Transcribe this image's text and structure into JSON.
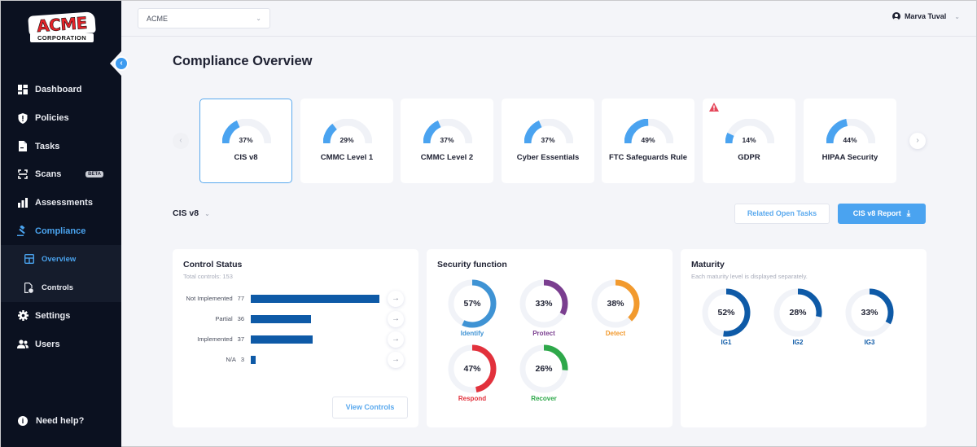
{
  "brand": {
    "logo_top": "ACME",
    "logo_bottom": "CORPORATION"
  },
  "sidebar": {
    "collapse_icon": "chevron-left-icon",
    "items": [
      {
        "label": "Dashboard",
        "icon": "dashboard-icon"
      },
      {
        "label": "Policies",
        "icon": "shield-icon"
      },
      {
        "label": "Tasks",
        "icon": "document-icon"
      },
      {
        "label": "Scans",
        "icon": "scan-icon",
        "badge": "BETA"
      },
      {
        "label": "Assessments",
        "icon": "bar-chart-icon"
      },
      {
        "label": "Compliance",
        "icon": "gavel-icon",
        "active": true
      }
    ],
    "sub_items": [
      {
        "label": "Overview",
        "icon": "layout-icon",
        "active": true
      },
      {
        "label": "Controls",
        "icon": "file-gear-icon"
      }
    ],
    "bottom_items": [
      {
        "label": "Settings",
        "icon": "gear-icon"
      },
      {
        "label": "Users",
        "icon": "users-icon"
      }
    ],
    "help": {
      "label": "Need help?",
      "icon": "info-icon"
    }
  },
  "topbar": {
    "org_select": {
      "value": "ACME"
    },
    "user": {
      "name": "Marva Tuval"
    }
  },
  "page": {
    "title": "Compliance Overview"
  },
  "frameworks": {
    "selected": "CIS v8",
    "accent": "#4aa3f0",
    "items": [
      {
        "name": "CIS v8",
        "percent": 37,
        "percent_label": "37%",
        "selected": true
      },
      {
        "name": "CMMC Level 1",
        "percent": 29,
        "percent_label": "29%"
      },
      {
        "name": "CMMC Level 2",
        "percent": 37,
        "percent_label": "37%"
      },
      {
        "name": "Cyber Essentials",
        "percent": 37,
        "percent_label": "37%"
      },
      {
        "name": "FTC Safeguards Rule",
        "percent": 49,
        "percent_label": "49%"
      },
      {
        "name": "GDPR",
        "percent": 14,
        "percent_label": "14%",
        "warning": true
      },
      {
        "name": "HIPAA Security",
        "percent": 44,
        "percent_label": "44%"
      }
    ]
  },
  "framework_bar": {
    "selector_label": "CIS v8",
    "related_tasks_label": "Related Open Tasks",
    "report_label": "CIS v8 Report",
    "report_icon": "download-icon"
  },
  "control_status": {
    "title": "Control Status",
    "subtitle": "Total controls: 153",
    "bar_color": "#0e5aa7",
    "max": 77,
    "rows": [
      {
        "label": "Not Implemented",
        "count": 77
      },
      {
        "label": "Partial",
        "count": 36
      },
      {
        "label": "Implemented",
        "count": 37
      },
      {
        "label": "N/A",
        "count": 3
      }
    ],
    "view_controls_label": "View Controls"
  },
  "security_function": {
    "title": "Security function",
    "items": [
      {
        "label": "Identify",
        "percent": 57,
        "percent_label": "57%",
        "color": "#3f93d4"
      },
      {
        "label": "Protect",
        "percent": 33,
        "percent_label": "33%",
        "color": "#7a3e8f"
      },
      {
        "label": "Detect",
        "percent": 38,
        "percent_label": "38%",
        "color": "#f29a2e"
      },
      {
        "label": "Respond",
        "percent": 47,
        "percent_label": "47%",
        "color": "#e2313c"
      },
      {
        "label": "Recover",
        "percent": 26,
        "percent_label": "26%",
        "color": "#2ea84a"
      }
    ]
  },
  "maturity": {
    "title": "Maturity",
    "subtitle": "Each maturity level is displayed separately.",
    "color": "#0e5aa7",
    "items": [
      {
        "label": "IG1",
        "percent": 52,
        "percent_label": "52%"
      },
      {
        "label": "IG2",
        "percent": 28,
        "percent_label": "28%"
      },
      {
        "label": "IG3",
        "percent": 33,
        "percent_label": "33%"
      }
    ]
  }
}
